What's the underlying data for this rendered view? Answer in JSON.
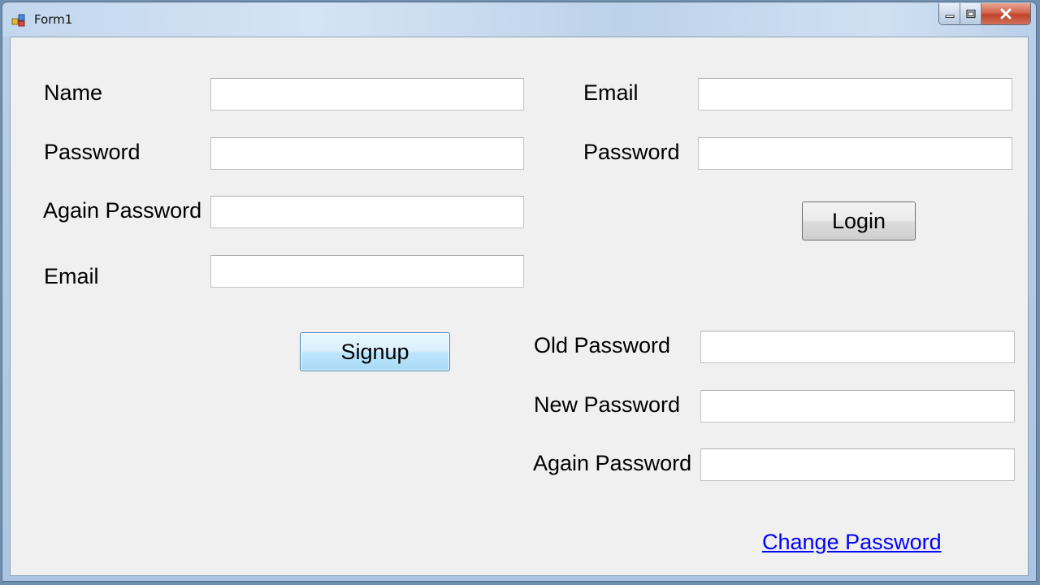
{
  "window": {
    "title": "Form1"
  },
  "signup": {
    "name_label": "Name",
    "password_label": "Password",
    "again_password_label": "Again Password",
    "email_label": "Email",
    "name_value": "",
    "password_value": "",
    "again_password_value": "",
    "email_value": "",
    "button_label": "Signup"
  },
  "login": {
    "email_label": "Email",
    "password_label": "Password",
    "email_value": "",
    "password_value": "",
    "button_label": "Login"
  },
  "change_password": {
    "old_password_label": "Old Password",
    "new_password_label": "New Password",
    "again_password_label": "Again Password",
    "old_password_value": "",
    "new_password_value": "",
    "again_password_value": "",
    "link_label": "Change Password"
  },
  "colors": {
    "link": "#0000ff",
    "form_background": "#f0f0f0",
    "close_button": "#c74a30"
  }
}
